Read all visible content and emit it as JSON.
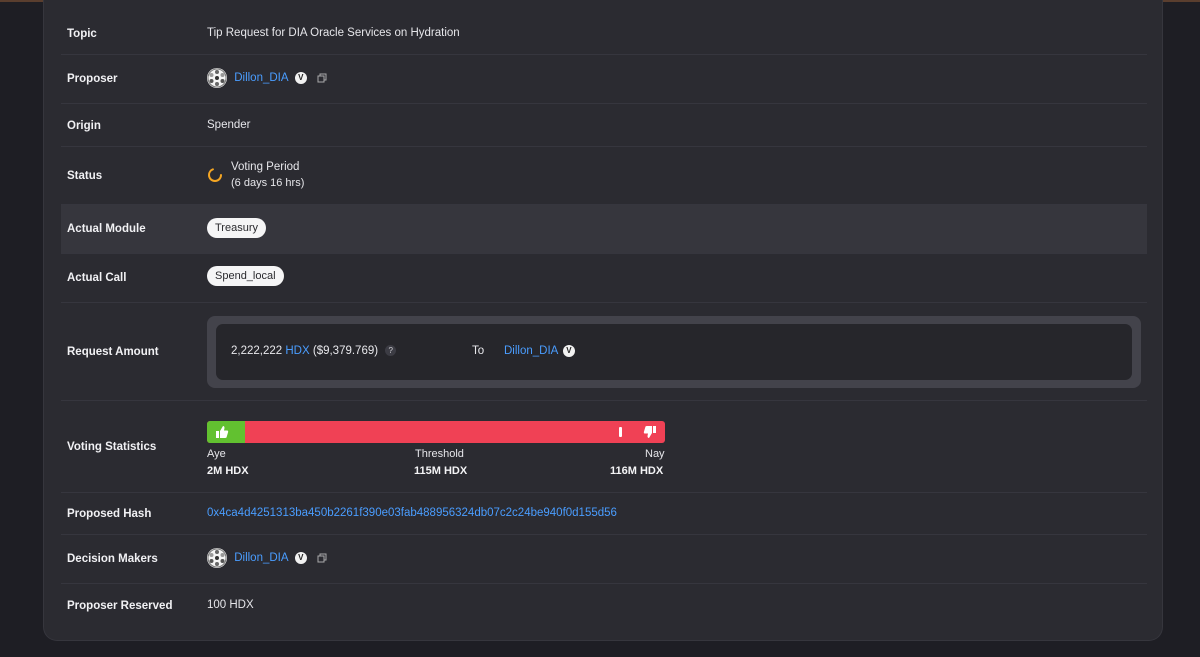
{
  "rows": {
    "topic": {
      "label": "Topic",
      "value": "Tip Request for DIA Oracle Services on Hydration"
    },
    "proposer": {
      "label": "Proposer",
      "name": "Dillon_DIA",
      "verified_mark": "V"
    },
    "origin": {
      "label": "Origin",
      "value": "Spender"
    },
    "status": {
      "label": "Status",
      "value": "Voting Period",
      "sub": "(6 days 16 hrs)"
    },
    "actual_module": {
      "label": "Actual Module",
      "value": "Treasury"
    },
    "actual_call": {
      "label": "Actual Call",
      "value": "Spend_local"
    },
    "request_amount": {
      "label": "Request Amount",
      "amount": "2,222,222",
      "token": "HDX",
      "usd": "($9,379.769)",
      "help": "?",
      "to_label": "To",
      "recipient": "Dillon_DIA",
      "verified_mark": "V"
    },
    "voting_statistics": {
      "label": "Voting Statistics",
      "aye_label": "Aye",
      "aye_value": "2M HDX",
      "threshold_label": "Threshold",
      "threshold_value": "115M HDX",
      "nay_label": "Nay",
      "nay_value": "116M HDX",
      "aye_fraction": 0.0169,
      "threshold_fraction": 0.9
    },
    "proposed_hash": {
      "label": "Proposed Hash",
      "value": "0x4ca4d4251313ba450b2261f390e03fab488956324db07c2c24be940f0d155d56"
    },
    "decision_makers": {
      "label": "Decision Makers",
      "name": "Dillon_DIA",
      "verified_mark": "V"
    },
    "proposer_reserved": {
      "label": "Proposer Reserved",
      "value": "100 HDX"
    }
  },
  "colors": {
    "accent_link": "#4a9dff",
    "aye_green": "#62c130",
    "nay_red": "#f04155",
    "status_ring": "#f5a623"
  },
  "icons": [
    "avatar-icon",
    "verified-icon",
    "copy-icon",
    "voting-period-spinner-icon",
    "help-icon",
    "thumbs-up-icon",
    "thumbs-down-icon"
  ]
}
